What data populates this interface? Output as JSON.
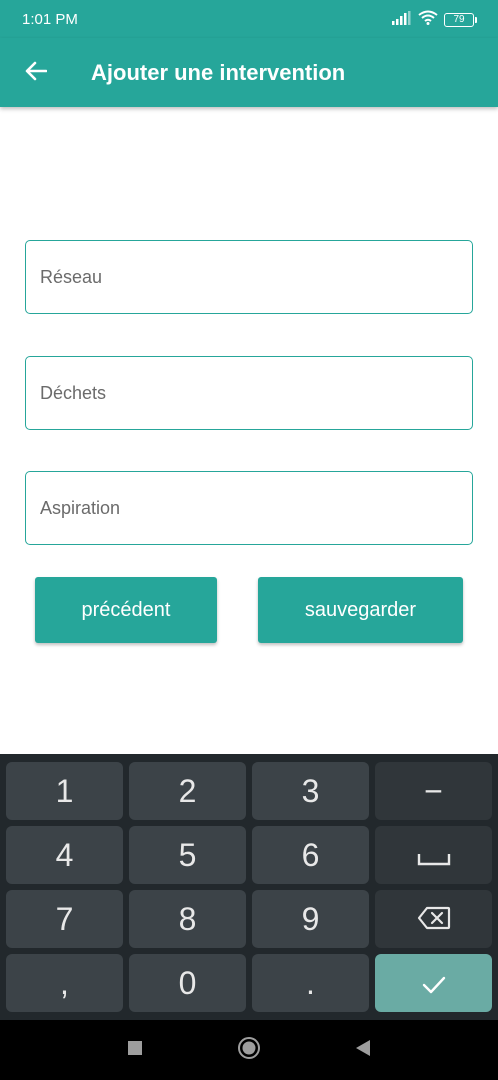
{
  "status_bar": {
    "time": "1:01 PM",
    "battery": "79"
  },
  "app_bar": {
    "title": "Ajouter une intervention"
  },
  "form": {
    "fields": [
      {
        "placeholder": "Réseau",
        "value": ""
      },
      {
        "placeholder": "Déchets",
        "value": ""
      },
      {
        "placeholder": "Aspiration",
        "value": ""
      }
    ],
    "previous_label": "précédent",
    "save_label": "sauvegarder"
  },
  "keyboard": {
    "k1": "1",
    "k2": "2",
    "k3": "3",
    "minus": "−",
    "k4": "4",
    "k5": "5",
    "k6": "6",
    "space": "space-icon",
    "k7": "7",
    "k8": "8",
    "k9": "9",
    "backspace": "backspace-icon",
    "comma": ",",
    "k0": "0",
    "dot": ".",
    "done": "check-icon"
  },
  "colors": {
    "accent": "#26a69a",
    "keyboard_bg": "#22282c",
    "key_bg": "#3c4348",
    "done_key": "#6aaba4"
  }
}
